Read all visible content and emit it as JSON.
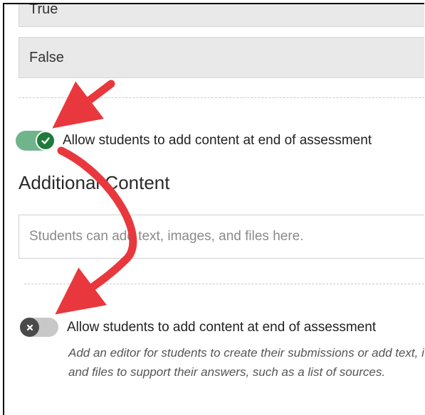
{
  "options": {
    "true_label": "True",
    "false_label": "False"
  },
  "toggle_on": {
    "label": "Allow students to add content at end of assessment",
    "state": "on",
    "icon": "check-icon",
    "color": "#1f7a3c"
  },
  "additional_content": {
    "title": "Additional Content",
    "placeholder": "Students can add text, images, and files here."
  },
  "toggle_off": {
    "label": "Allow students to add content at end of assessment",
    "state": "off",
    "icon": "x-icon",
    "help_line1": "Add an editor for students to create their submissions or add text, images,",
    "help_line2": "and files to support their answers, such as a list of sources."
  },
  "annotation": {
    "arrow_color": "#e8383d"
  }
}
